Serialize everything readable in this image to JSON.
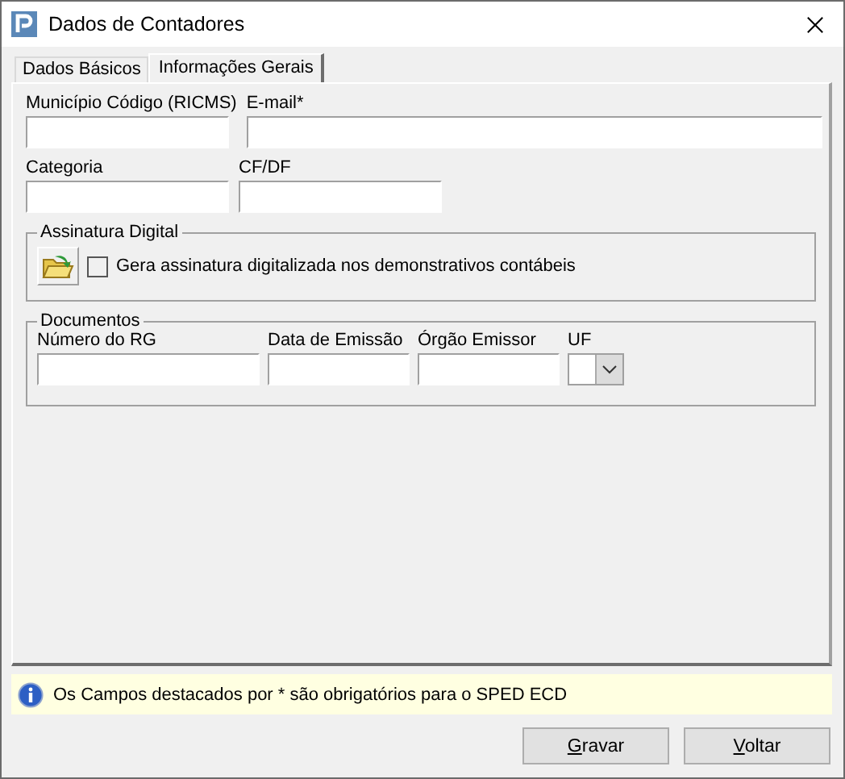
{
  "window": {
    "title": "Dados de Contadores"
  },
  "tabs": [
    {
      "label": "Dados Básicos",
      "selected": false
    },
    {
      "label": "Informações Gerais",
      "selected": true
    }
  ],
  "fields_row1": [
    {
      "label": "Município Código (RICMS)"
    },
    {
      "label": "E-mail*"
    }
  ],
  "fields_row2": [
    {
      "label": "Categoria"
    },
    {
      "label": "CF/DF"
    }
  ],
  "assinatura": {
    "title": "Assinatura Digital",
    "checkbox": {
      "label": "Gera assinatura digitalizada nos demonstrativos contábeis",
      "checked": false
    }
  },
  "documentos": {
    "title": "Documentos",
    "fields": [
      {
        "label": "Número do RG",
        "kind": "text"
      },
      {
        "label": "Data de Emissão",
        "kind": "text"
      },
      {
        "label": "Órgão Emissor",
        "kind": "text"
      },
      {
        "label": "UF",
        "kind": "combo"
      }
    ]
  },
  "info": {
    "text": "Os Campos destacados por * são obrigatórios para o SPED ECD"
  },
  "buttons": [
    {
      "mnemonic": "G",
      "rest": "ravar"
    },
    {
      "mnemonic": "V",
      "rest": "oltar"
    }
  ]
}
